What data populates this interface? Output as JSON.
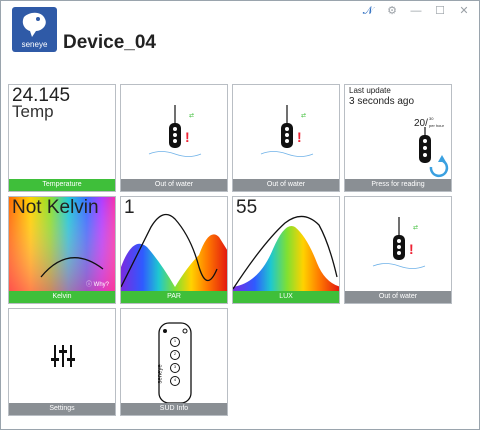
{
  "window": {
    "controls": [
      {
        "name": "app-icon",
        "glyph": "𝒩"
      },
      {
        "name": "settings-icon",
        "glyph": "⚙"
      },
      {
        "name": "minimize-button",
        "glyph": "—"
      },
      {
        "name": "maximize-button",
        "glyph": "☐"
      },
      {
        "name": "close-button",
        "glyph": "✕"
      }
    ]
  },
  "header": {
    "logo_text": "seneye",
    "device_name": "Device_04"
  },
  "tiles": {
    "temperature": {
      "value": "24.145",
      "unit": "Temp",
      "label": "Temperature"
    },
    "out_of_water_1": {
      "label": "Out of water"
    },
    "out_of_water_2": {
      "label": "Out of water"
    },
    "reading": {
      "last_update_label": "Last update",
      "last_update_value": "3 seconds ago",
      "rate_value": "20/",
      "rate_sup": "30",
      "rate_unit": "per hour",
      "label": "Press for reading"
    },
    "kelvin": {
      "value": "Not Kelvin",
      "why": "Why?",
      "label": "Kelvin"
    },
    "par": {
      "value": "1",
      "label": "PAR"
    },
    "lux": {
      "value": "55",
      "label": "LUX"
    },
    "out_of_water_3": {
      "label": "Out of water"
    },
    "settings": {
      "label": "Settings"
    },
    "sud_info": {
      "label": "SUD Info",
      "device_brand": "seneye",
      "button_labels": [
        "1",
        "2",
        "3",
        "4"
      ]
    }
  },
  "colors": {
    "brand": "#2f5aa7",
    "label_green": "#3fbf3a",
    "label_gray": "#8a8f94",
    "refresh": "#3aa0e0"
  }
}
